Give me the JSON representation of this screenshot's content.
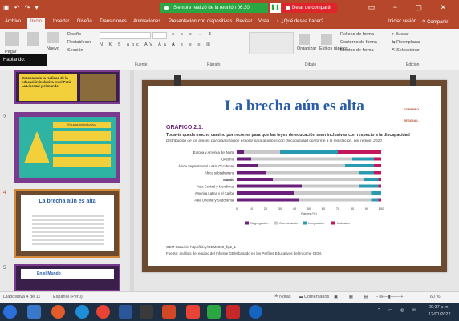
{
  "titlebar": {
    "meeting_banner": "Siempre realizó de la reunión 06:30",
    "stop_share": "Dejar de compartir"
  },
  "menu": {
    "tabs": [
      "Archivo",
      "Inicio",
      "Insertar",
      "Diseño",
      "Transiciones",
      "Animaciones",
      "Presentación con diapositivas",
      "Revisar",
      "Vista"
    ],
    "tell_me": "¿Qué desea hacer?",
    "signin": "Iniciar sesión",
    "share": "Compartir"
  },
  "ribbon": {
    "paste": "Pegar",
    "new_slide": "Nuevo",
    "design": "Diseño",
    "reset": "Restablecer",
    "section": "Sección",
    "arrange": "Organizar",
    "styles": "Estilos rápidos",
    "fill": "Relleno de forma",
    "outline": "Contorno de forma",
    "effects": "Efectos de forma",
    "find": "Buscar",
    "replace": "Reemplazar",
    "select": "Seleccionar",
    "groups": [
      "Fuente",
      "Párrafo",
      "Dibujo",
      "Edición"
    ]
  },
  "speaking": "Hablando:",
  "thumbnails": [
    {
      "num": "",
      "text": "Desconando la realidad de la educación inclusiva en el Perú, La Libertad y el mundo."
    },
    {
      "num": "2",
      "text": "Educación inclusiva"
    },
    {
      "num": "4",
      "text": "La brecha aún es alta"
    },
    {
      "num": "5",
      "text": "En el Mundo"
    }
  ],
  "slide": {
    "title": "La brecha aún es alta",
    "brand": "GOBIERNO REGIONAL",
    "figure_label": "GRÁFICO 2.1:",
    "headline": "Todavía queda mucho camino por recorrer para que las leyes de educación sean inclusivas con respecto a la discapacidad",
    "subhead": "Distribución de los países por organización escolar para alumnos con discapacidad conforme a la legislación, por región, 2020",
    "source_line": "GEM StatLink: http://bit.ly/GEM2020_fig2_1",
    "source_note": "Fuente: análisis del equipo del Informe GEM basado en los Perfiles Educativos del Informe GEM."
  },
  "chart_data": {
    "type": "bar",
    "stacked": true,
    "orientation": "horizontal",
    "categories": [
      "Europa y América del Norte",
      "Oceanía",
      "África Septentrional y Asia Occidental",
      "África subsahariana",
      "Mundo",
      "Asia Central y Meridional",
      "América Latina y el Caribe",
      "Asia Oriental y Sudoriental"
    ],
    "series": [
      {
        "name": "Segregación",
        "color": "#6b1f7a",
        "values": [
          5,
          10,
          15,
          20,
          25,
          45,
          40,
          43
        ]
      },
      {
        "name": "Combinación",
        "color": "#c9c9c9",
        "values": [
          25,
          70,
          60,
          65,
          63,
          40,
          53,
          50
        ]
      },
      {
        "name": "Integración",
        "color": "#2a9ab0",
        "values": [
          40,
          15,
          20,
          10,
          10,
          13,
          7,
          5
        ]
      },
      {
        "name": "Inclusión",
        "color": "#c2185b",
        "values": [
          30,
          5,
          5,
          5,
          2,
          2,
          0,
          2
        ]
      }
    ],
    "xticks": [
      0,
      10,
      20,
      30,
      40,
      50,
      60,
      70,
      80,
      90,
      100
    ],
    "xlabel": "Países (%)",
    "xlim": [
      0,
      100
    ]
  },
  "status": {
    "slide_of": "Diapositiva 4 de 11",
    "language": "Español (Perú)",
    "notes": "Notas",
    "comments": "Comentarios",
    "zoom": "60 %"
  },
  "taskbar": {
    "time": "09:37 p.m.",
    "date": "12/01/2022"
  },
  "colors": {
    "accent": "#b7472a",
    "slide_frame": "#6b4a2f",
    "title_blue": "#2a5da8",
    "purple": "#6b1f7a"
  }
}
